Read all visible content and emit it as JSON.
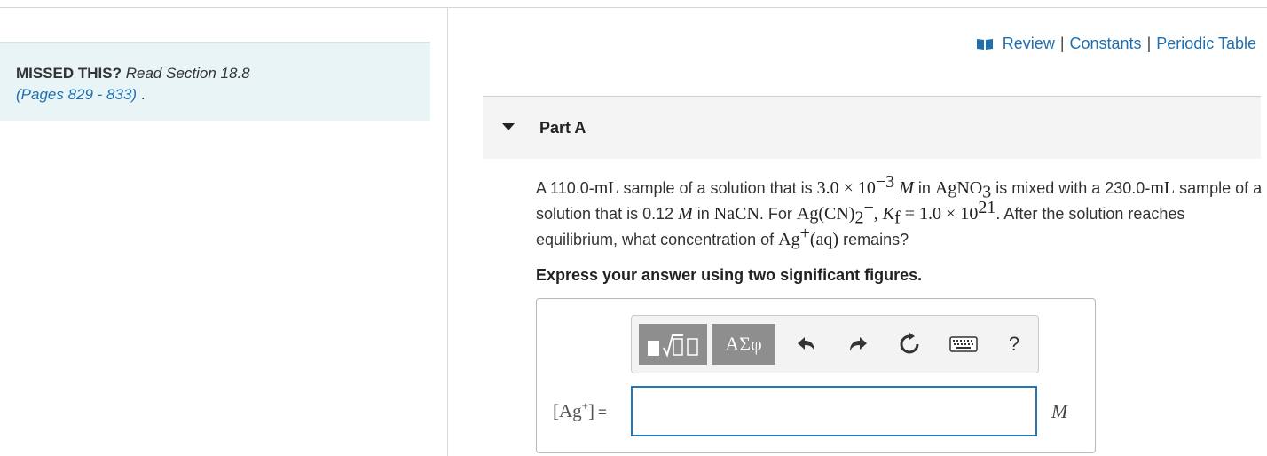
{
  "hint": {
    "missed_label": "MISSED THIS?",
    "read_text": "Read Section 18.8",
    "pages_link": "(Pages 829 - 833)",
    "trailing": " ."
  },
  "resources": {
    "review": "Review",
    "separator": "|",
    "constants": "Constants",
    "periodic_table": "Periodic Table"
  },
  "part": {
    "title": "Part A"
  },
  "question": {
    "t1": "A 110.0-",
    "unit_mL": "mL",
    "t2": " sample of a solution that is ",
    "conc_mantissa": "3.0 × 10",
    "conc_exp": "−3",
    "molar": "M",
    "t3": " in ",
    "agno3_base": "AgNO",
    "agno3_sub": "3",
    "t4": " is mixed with a 230.0-",
    "t5": " sample of a solution that is 0.12 ",
    "t6": " in ",
    "nacn": "NaCN",
    "t7": ". For ",
    "complex_base": "Ag(CN)",
    "complex_sub": "2",
    "complex_sup": "−",
    "comma": ", ",
    "kf_k": "K",
    "kf_sub": "f",
    "kf_value": " = 1.0 × 10",
    "kf_exp": "21",
    "t8": ". After the solution reaches equilibrium, what concentration of ",
    "ag_base": "Ag",
    "ag_sup": "+",
    "ag_aq": "(aq)",
    "t9": " remains?"
  },
  "instruction": "Express your answer using two significant figures.",
  "toolbar": {
    "templates_icon": "templates-icon",
    "greek_label": "ΑΣφ",
    "undo_icon": "undo-icon",
    "redo_icon": "redo-icon",
    "reset_icon": "reset-icon",
    "keyboard_icon": "keyboard-icon",
    "help_label": "?"
  },
  "answer": {
    "label_open": "[Ag",
    "label_sup": "+",
    "label_close": "]",
    "equals": "=",
    "value": "",
    "unit": "M"
  },
  "colors": {
    "link": "#1f6fb0",
    "hint_bg": "#e8f4f6",
    "input_border": "#2277b8",
    "toolbar_button": "#8e8e8e"
  }
}
